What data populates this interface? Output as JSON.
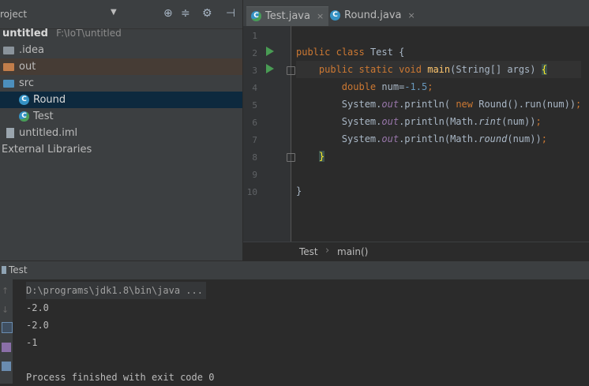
{
  "project": {
    "title": "roject",
    "dropdown_caret": "▼",
    "toolbar_icons": [
      "crosshair-icon",
      "collapse-icon",
      "gear-icon",
      "hide-icon"
    ],
    "tree": [
      {
        "label": "untitled",
        "path": "F:\\IoT\\untitled",
        "kind": "root"
      },
      {
        "label": ".idea",
        "kind": "folder-grey"
      },
      {
        "label": "out",
        "kind": "folder-orange"
      },
      {
        "label": "src",
        "kind": "folder-blue"
      },
      {
        "label": "Round",
        "kind": "class"
      },
      {
        "label": "Test",
        "kind": "class"
      },
      {
        "label": "untitled.iml",
        "kind": "iml"
      },
      {
        "label": "External Libraries",
        "kind": "libs"
      }
    ]
  },
  "editor": {
    "tabs": [
      {
        "label": "Test.java",
        "active": true
      },
      {
        "label": "Round.java",
        "active": false
      }
    ],
    "close_glyph": "×",
    "class_glyph": "C",
    "line_numbers": [
      "1",
      "2",
      "3",
      "4",
      "5",
      "6",
      "7",
      "8",
      "9",
      "10"
    ],
    "code": {
      "l2_kw1": "public",
      "l2_kw2": "class",
      "l2_name": "Test {",
      "l3_kw1": "public",
      "l3_kw2": "static",
      "l3_kw3": "void",
      "l3_fn": "main",
      "l3_rest": "(String[] args) ",
      "l3_brace": "{",
      "l4_kw": "double",
      "l4_var": "num=",
      "l4_num": "-1.5",
      "l4_semi": ";",
      "l5_a": "System.",
      "l5_out": "out",
      "l5_b": ".println( ",
      "l5_kw": "new",
      "l5_c": " Round().run(num))",
      "l5_semi": ";",
      "l6_a": "System.",
      "l6_out": "out",
      "l6_b": ".println(Math.",
      "l6_m": "rint",
      "l6_c": "(num))",
      "l6_semi": ";",
      "l7_a": "System.",
      "l7_out": "out",
      "l7_b": ".println(Math.",
      "l7_m": "round",
      "l7_c": "(num))",
      "l7_semi": ";",
      "l8_brace": "}",
      "l10_brace": "}"
    },
    "breadcrumb": [
      "Test",
      "main()"
    ]
  },
  "run": {
    "title": "Test",
    "console": [
      "D:\\programs\\jdk1.8\\bin\\java ...",
      "-2.0",
      "-2.0",
      "-1",
      "",
      "Process finished with exit code 0"
    ]
  },
  "colors": {
    "background": "#2b2b2b",
    "panel": "#3c3f41",
    "keyword": "#cc7832",
    "method": "#ffc66d",
    "number": "#6897bb",
    "static_field": "#9876aa",
    "selection": "#0d293e",
    "run_green": "#499c54"
  }
}
